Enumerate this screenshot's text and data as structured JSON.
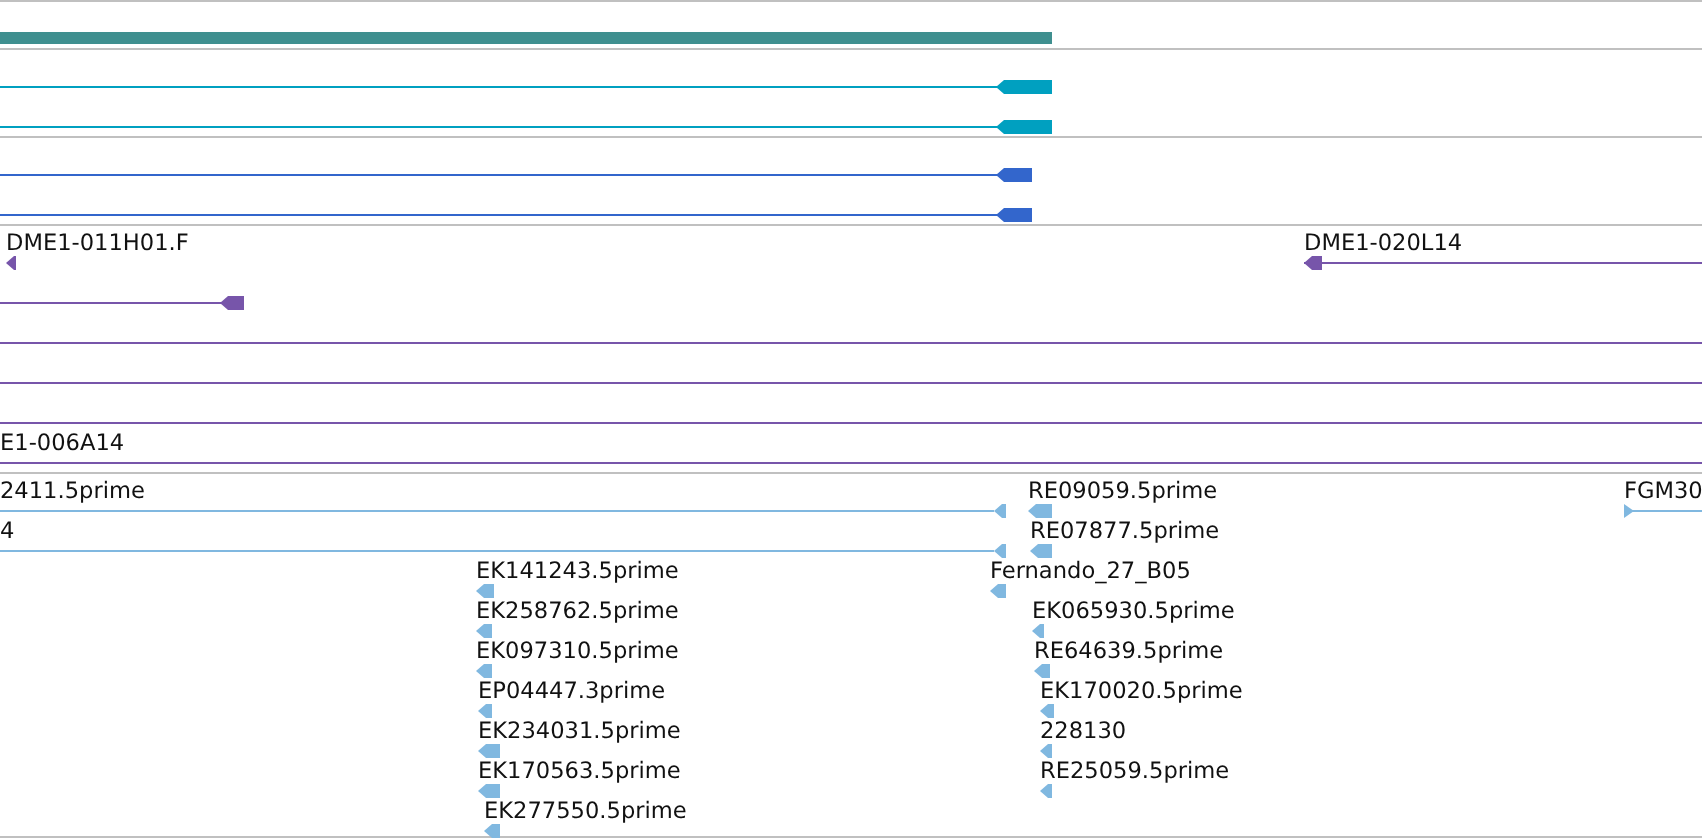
{
  "tracks": [
    {
      "color": "#3f8f8f",
      "features": [
        {
          "kind": "block"
        }
      ]
    },
    {
      "color": "#00a0c0",
      "features": [
        {
          "kind": "arrow"
        },
        {
          "kind": "arrow"
        }
      ]
    },
    {
      "color": "#3366cc",
      "features": [
        {
          "kind": "arrow"
        },
        {
          "kind": "arrow"
        }
      ]
    },
    {
      "color": "#7755aa",
      "features": [
        {
          "kind": "arrow",
          "label": "DME1-011H01.F"
        },
        {
          "kind": "arrow",
          "label": "DME1-020L14"
        },
        {
          "kind": "arrow"
        },
        {
          "kind": "line"
        },
        {
          "kind": "line"
        },
        {
          "kind": "line"
        },
        {
          "kind": "line",
          "label": "E1-006A14"
        }
      ]
    },
    {
      "color": "#80b8e0",
      "features": [
        {
          "kind": "arrow",
          "label": "2411.5prime"
        },
        {
          "kind": "arrow",
          "label": "RE09059.5prime"
        },
        {
          "kind": "arrow",
          "label": "FGM30"
        },
        {
          "kind": "arrow",
          "label": "4"
        },
        {
          "kind": "arrow",
          "label": "RE07877.5prime"
        },
        {
          "kind": "arrow",
          "label": "EK141243.5prime"
        },
        {
          "kind": "arrow",
          "label": "Fernando_27_B05"
        },
        {
          "kind": "arrow",
          "label": "EK258762.5prime"
        },
        {
          "kind": "arrow",
          "label": "EK065930.5prime"
        },
        {
          "kind": "arrow",
          "label": "EK097310.5prime"
        },
        {
          "kind": "arrow",
          "label": "RE64639.5prime"
        },
        {
          "kind": "arrow",
          "label": "EP04447.3prime"
        },
        {
          "kind": "arrow",
          "label": "EK170020.5prime"
        },
        {
          "kind": "arrow",
          "label": "EK234031.5prime"
        },
        {
          "kind": "arrow",
          "label": "228130"
        },
        {
          "kind": "arrow",
          "label": "EK170563.5prime"
        },
        {
          "kind": "arrow",
          "label": "RE25059.5prime"
        },
        {
          "kind": "arrow",
          "label": "EK277550.5prime"
        }
      ]
    }
  ]
}
